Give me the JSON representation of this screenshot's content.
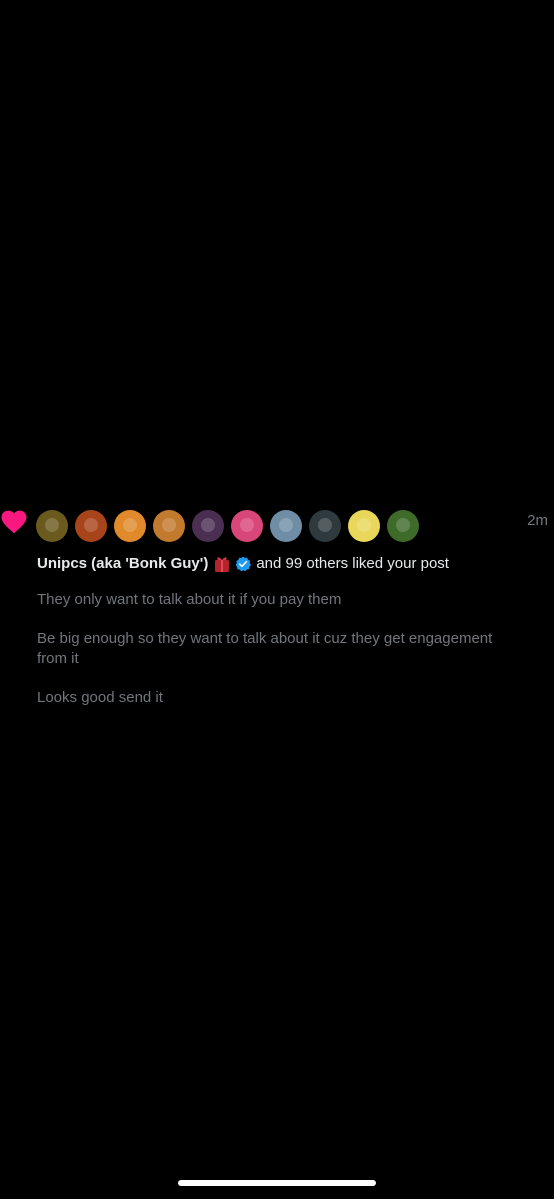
{
  "notification": {
    "timestamp": "2m",
    "user_name": "Unipcs (aka 'Bonk Guy')",
    "rest_text": "and 99 others liked your post",
    "post_lines": [
      "They only want to talk about it if you pay them",
      "Be big enough so they want to talk about it cuz they get engagement from it",
      "Looks good send it"
    ],
    "avatars": [
      {
        "icon": "avatar-icon",
        "color": "#6b5a1e"
      },
      {
        "icon": "avatar-icon",
        "color": "#a8441a"
      },
      {
        "icon": "avatar-icon",
        "color": "#e08a2c"
      },
      {
        "icon": "avatar-icon",
        "color": "#c27a2e"
      },
      {
        "icon": "avatar-icon",
        "color": "#4b2f52"
      },
      {
        "icon": "avatar-icon",
        "color": "#d9467a"
      },
      {
        "icon": "avatar-icon",
        "color": "#6f8ea6"
      },
      {
        "icon": "avatar-icon",
        "color": "#2f3a3e"
      },
      {
        "icon": "avatar-icon",
        "color": "#e8d75a"
      },
      {
        "icon": "avatar-icon",
        "color": "#3f6b2a"
      }
    ]
  },
  "colors": {
    "background": "#000000",
    "heart": "#f91880",
    "verified": "#1d9bf0",
    "primary_text": "#e7e9ea",
    "secondary_text": "#71767b"
  }
}
